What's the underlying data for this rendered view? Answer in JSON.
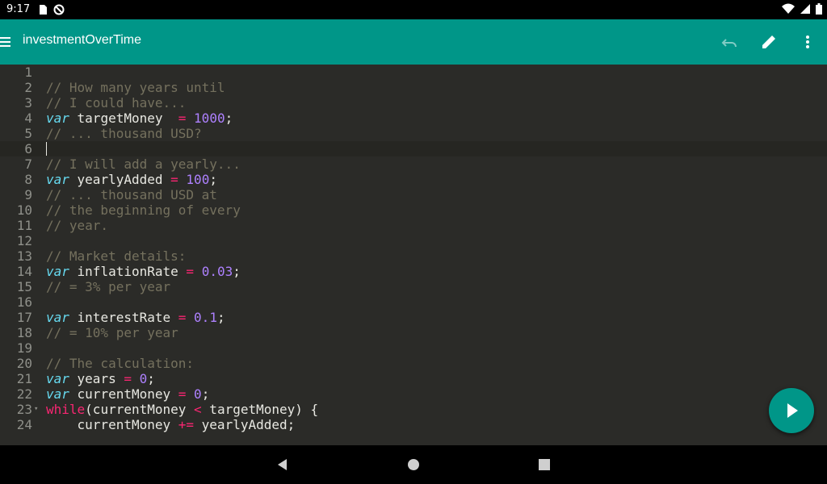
{
  "status_bar": {
    "time": "9:17",
    "icons_left": [
      "sd-card-icon",
      "do-not-disturb-icon"
    ],
    "icons_right": [
      "wifi-icon",
      "signal-icon",
      "battery-icon"
    ]
  },
  "app_bar": {
    "title": "investmentOverTime",
    "color": "#009688",
    "actions": [
      "undo-icon",
      "edit-icon",
      "more-vert-icon"
    ]
  },
  "editor": {
    "active_line": 6,
    "lines": [
      {
        "n": "1",
        "tokens": []
      },
      {
        "n": "2",
        "tokens": [
          {
            "t": "// How many years until",
            "c": "cm"
          }
        ]
      },
      {
        "n": "3",
        "tokens": [
          {
            "t": "// I could have...",
            "c": "cm"
          }
        ]
      },
      {
        "n": "4",
        "tokens": [
          {
            "t": "var",
            "c": "kw"
          },
          {
            "t": " targetMoney  ",
            "c": ""
          },
          {
            "t": "=",
            "c": "op"
          },
          {
            "t": " ",
            "c": ""
          },
          {
            "t": "1000",
            "c": "num"
          },
          {
            "t": ";",
            "c": ""
          }
        ]
      },
      {
        "n": "5",
        "tokens": [
          {
            "t": "// ... thousand USD?",
            "c": "cm"
          }
        ]
      },
      {
        "n": "6",
        "tokens": []
      },
      {
        "n": "7",
        "tokens": [
          {
            "t": "// I will add a yearly...",
            "c": "cm"
          }
        ]
      },
      {
        "n": "8",
        "tokens": [
          {
            "t": "var",
            "c": "kw"
          },
          {
            "t": " yearlyAdded ",
            "c": ""
          },
          {
            "t": "=",
            "c": "op"
          },
          {
            "t": " ",
            "c": ""
          },
          {
            "t": "100",
            "c": "num"
          },
          {
            "t": ";",
            "c": ""
          }
        ]
      },
      {
        "n": "9",
        "tokens": [
          {
            "t": "// ... thousand USD at",
            "c": "cm"
          }
        ]
      },
      {
        "n": "10",
        "tokens": [
          {
            "t": "// the beginning of every",
            "c": "cm"
          }
        ]
      },
      {
        "n": "11",
        "tokens": [
          {
            "t": "// year.",
            "c": "cm"
          }
        ]
      },
      {
        "n": "12",
        "tokens": []
      },
      {
        "n": "13",
        "tokens": [
          {
            "t": "// Market details:",
            "c": "cm"
          }
        ]
      },
      {
        "n": "14",
        "tokens": [
          {
            "t": "var",
            "c": "kw"
          },
          {
            "t": " inflationRate ",
            "c": ""
          },
          {
            "t": "=",
            "c": "op"
          },
          {
            "t": " ",
            "c": ""
          },
          {
            "t": "0.03",
            "c": "num"
          },
          {
            "t": ";",
            "c": ""
          }
        ]
      },
      {
        "n": "15",
        "tokens": [
          {
            "t": "// = 3% per year",
            "c": "cm"
          }
        ]
      },
      {
        "n": "16",
        "tokens": []
      },
      {
        "n": "17",
        "tokens": [
          {
            "t": "var",
            "c": "kw"
          },
          {
            "t": " interestRate ",
            "c": ""
          },
          {
            "t": "=",
            "c": "op"
          },
          {
            "t": " ",
            "c": ""
          },
          {
            "t": "0.1",
            "c": "num"
          },
          {
            "t": ";",
            "c": ""
          }
        ]
      },
      {
        "n": "18",
        "tokens": [
          {
            "t": "// = 10% per year",
            "c": "cm"
          }
        ]
      },
      {
        "n": "19",
        "tokens": []
      },
      {
        "n": "20",
        "tokens": [
          {
            "t": "// The calculation:",
            "c": "cm"
          }
        ]
      },
      {
        "n": "21",
        "tokens": [
          {
            "t": "var",
            "c": "kw"
          },
          {
            "t": " years ",
            "c": ""
          },
          {
            "t": "=",
            "c": "op"
          },
          {
            "t": " ",
            "c": ""
          },
          {
            "t": "0",
            "c": "num"
          },
          {
            "t": ";",
            "c": ""
          }
        ]
      },
      {
        "n": "22",
        "tokens": [
          {
            "t": "var",
            "c": "kw"
          },
          {
            "t": " currentMoney ",
            "c": ""
          },
          {
            "t": "=",
            "c": "op"
          },
          {
            "t": " ",
            "c": ""
          },
          {
            "t": "0",
            "c": "num"
          },
          {
            "t": ";",
            "c": ""
          }
        ]
      },
      {
        "n": "23",
        "fold": true,
        "tokens": [
          {
            "t": "while",
            "c": "kw2"
          },
          {
            "t": "(currentMoney ",
            "c": ""
          },
          {
            "t": "<",
            "c": "op"
          },
          {
            "t": " targetMoney) {",
            "c": ""
          }
        ]
      },
      {
        "n": "24",
        "tokens": [
          {
            "t": "    currentMoney ",
            "c": ""
          },
          {
            "t": "+=",
            "c": "op"
          },
          {
            "t": " yearlyAdded;",
            "c": ""
          }
        ]
      }
    ]
  },
  "fab": {
    "icon": "play-icon",
    "color": "#009688"
  },
  "nav_bar": {
    "buttons": [
      "back-icon",
      "home-icon",
      "recents-icon"
    ]
  }
}
